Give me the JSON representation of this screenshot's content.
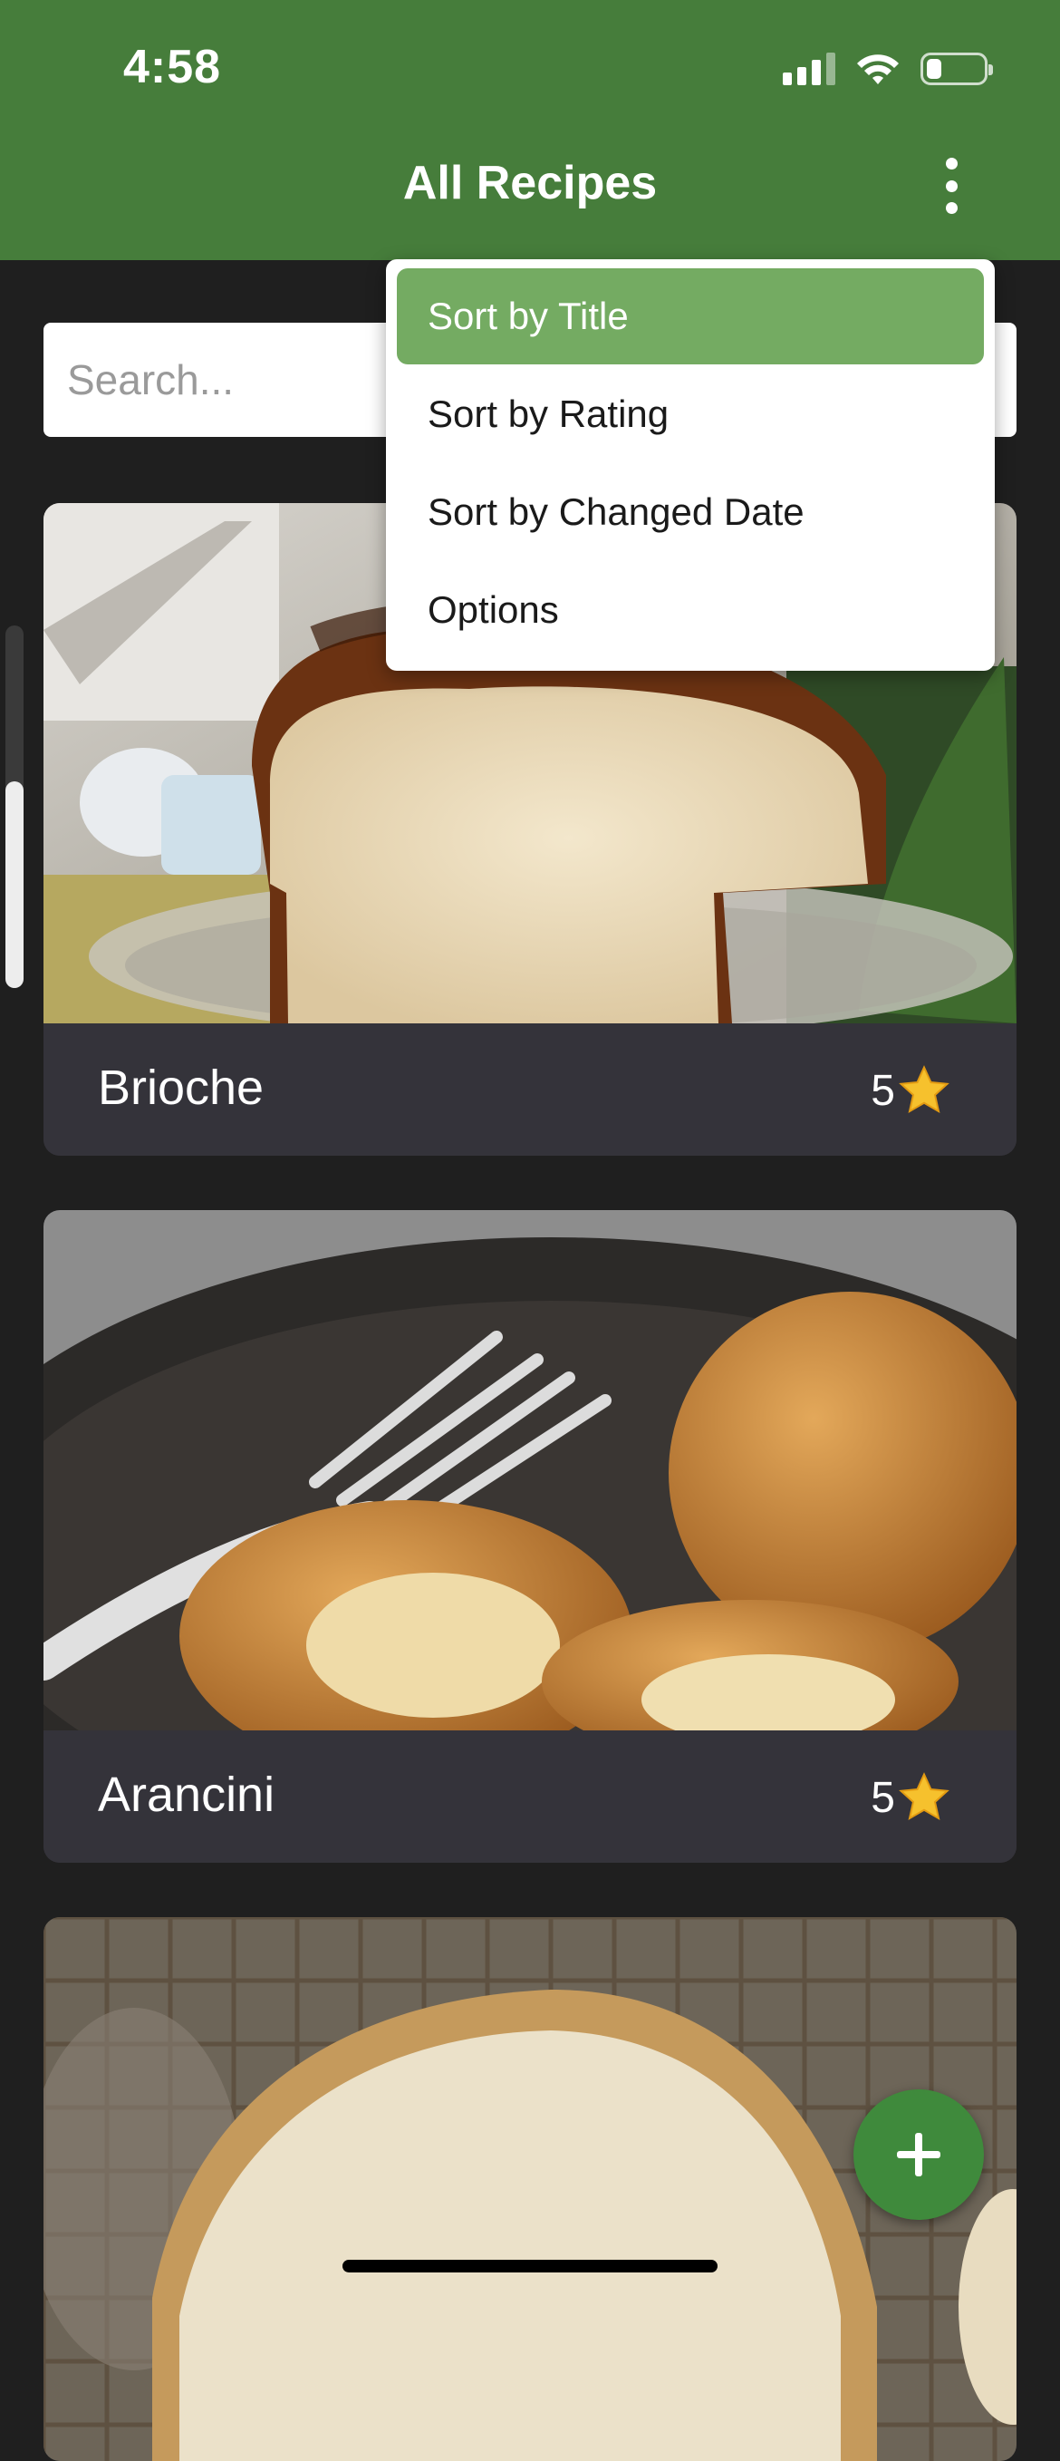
{
  "status_bar": {
    "time": "4:58"
  },
  "header": {
    "title": "All Recipes"
  },
  "search": {
    "placeholder": "Search..."
  },
  "menu": {
    "items": [
      {
        "label": "Sort by Title",
        "selected": true
      },
      {
        "label": "Sort by Rating",
        "selected": false
      },
      {
        "label": "Sort by Changed Date",
        "selected": false
      },
      {
        "label": "Options",
        "selected": false
      }
    ]
  },
  "recipes": [
    {
      "title": "Brioche",
      "rating": "5",
      "icon": "star-icon"
    },
    {
      "title": "Arancini",
      "rating": "5",
      "icon": "star-icon"
    }
  ],
  "colors": {
    "header": "#467d3b",
    "menu_selected": "#74ab62",
    "fab": "#3f8a3c",
    "card_footer": "#34333a",
    "background": "#1f1f1f"
  },
  "fab": {
    "icon": "plus-icon"
  }
}
